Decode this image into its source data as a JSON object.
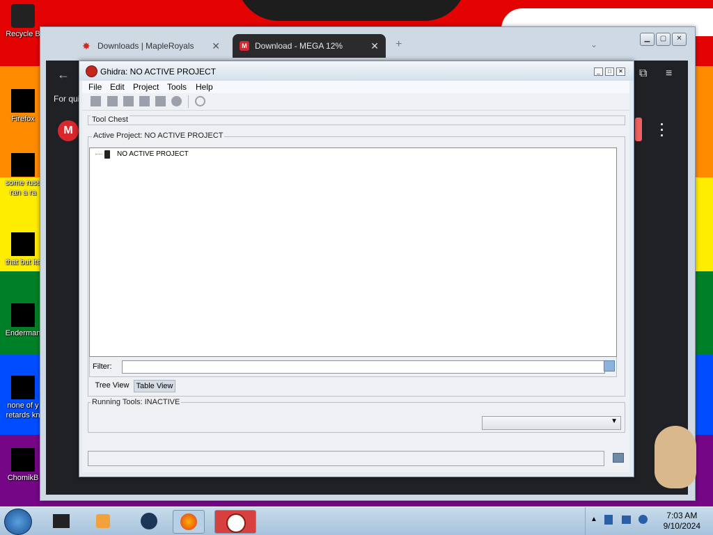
{
  "desktop": {
    "icons": [
      {
        "label": "Recycle B"
      },
      {
        "label": "Firefox"
      },
      {
        "label": "some russ ran a ra"
      },
      {
        "label": "that but its"
      },
      {
        "label": "Enderman"
      },
      {
        "label": "none of y retards kn"
      },
      {
        "label": "ChomikB"
      }
    ]
  },
  "browser": {
    "tabs": [
      {
        "label": "Downloads | MapleRoyals"
      },
      {
        "label": "Download - MEGA 12%"
      }
    ],
    "new_tab": "+",
    "partial_text": "For qui"
  },
  "ghidra": {
    "title": "Ghidra: NO ACTIVE PROJECT",
    "menu": [
      "File",
      "Edit",
      "Project",
      "Tools",
      "Help"
    ],
    "tool_chest_label": "Tool Chest",
    "active_project_label": "Active Project: NO ACTIVE PROJECT",
    "tree_root": "NO ACTIVE PROJECT",
    "filter_label": "Filter:",
    "filter_value": "",
    "tabs": [
      "Tree View",
      "Table View"
    ],
    "running_tools_label": "Running Tools: INACTIVE"
  },
  "taskbar": {
    "time": "7:03 AM",
    "date": "9/10/2024"
  },
  "colors": {
    "wallpaper_stripes": [
      "#e40303",
      "#ff8c00",
      "#ffed00",
      "#008026",
      "#004dff",
      "#750787"
    ],
    "mega_red": "#d9272e"
  }
}
